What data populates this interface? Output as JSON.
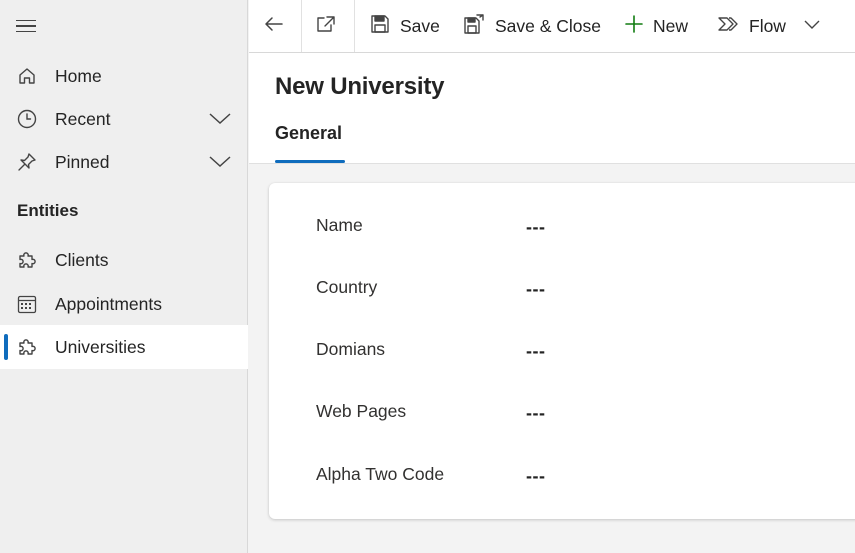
{
  "sidebar": {
    "items": [
      {
        "label": "Home",
        "icon": "home-icon"
      },
      {
        "label": "Recent",
        "icon": "clock-icon",
        "expandable": true
      },
      {
        "label": "Pinned",
        "icon": "pin-icon",
        "expandable": true
      }
    ],
    "section_title": "Entities",
    "entities": [
      {
        "label": "Clients",
        "icon": "puzzle-icon"
      },
      {
        "label": "Appointments",
        "icon": "calendar-icon"
      },
      {
        "label": "Universities",
        "icon": "puzzle-icon",
        "active": true
      }
    ]
  },
  "toolbar": {
    "back_icon": "arrow-left-icon",
    "popout_icon": "open-in-new-window-icon",
    "save_label": "Save",
    "save_close_label": "Save & Close",
    "new_label": "New",
    "flow_label": "Flow"
  },
  "page": {
    "title": "New University",
    "tabs": [
      {
        "label": "General",
        "selected": true
      }
    ]
  },
  "form": {
    "fields": [
      {
        "label": "Name",
        "value": "---"
      },
      {
        "label": "Country",
        "value": "---"
      },
      {
        "label": "Domians",
        "value": "---"
      },
      {
        "label": "Web Pages",
        "value": "---"
      },
      {
        "label": "Alpha Two Code",
        "value": "---"
      }
    ]
  },
  "colors": {
    "accent": "#0f6cbd",
    "new_plus": "#107c10",
    "sidebar_bg": "#efefef",
    "page_bg": "#f3f3f3"
  }
}
